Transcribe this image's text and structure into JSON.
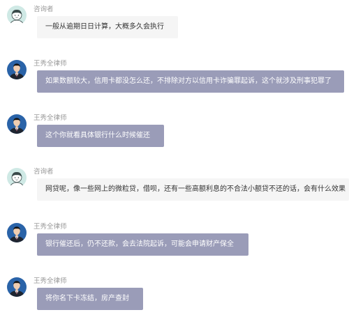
{
  "colors": {
    "client_bubble_bg": "#f5f5f5",
    "lawyer_bubble_bg": "#9a9cb8",
    "client_avatar_bg": "#cfe9e5",
    "name_text": "#9a9a9a"
  },
  "messages": [
    {
      "role": "client",
      "avatar_icon": "client-avatar-icon",
      "sender": "咨询者",
      "text": "一般从逾期日日计算，大概多久会执行"
    },
    {
      "role": "lawyer",
      "avatar_icon": "lawyer-avatar-icon",
      "sender": "王秀全律师",
      "text": "如果数额较大，信用卡都没怎么还，不排除对方以信用卡诈骗罪起诉，这个就涉及刑事犯罪了"
    },
    {
      "role": "lawyer",
      "avatar_icon": "lawyer-avatar-icon",
      "sender": "王秀全律师",
      "text": "这个你就看具体银行什么时候催还"
    },
    {
      "role": "client",
      "avatar_icon": "client-avatar-icon",
      "sender": "咨询者",
      "text": "网贷呢，像一些网上的微粒贷，借呗，还有一些高额利息的不合法小额贷不还的话，会有什么效果"
    },
    {
      "role": "lawyer",
      "avatar_icon": "lawyer-avatar-icon",
      "sender": "王秀全律师",
      "text": "银行催还后，仍不还款，会去法院起诉，可能会申请财产保全"
    },
    {
      "role": "lawyer",
      "avatar_icon": "lawyer-avatar-icon",
      "sender": "王秀全律师",
      "text": "将你名下卡冻结，房产查封"
    }
  ]
}
